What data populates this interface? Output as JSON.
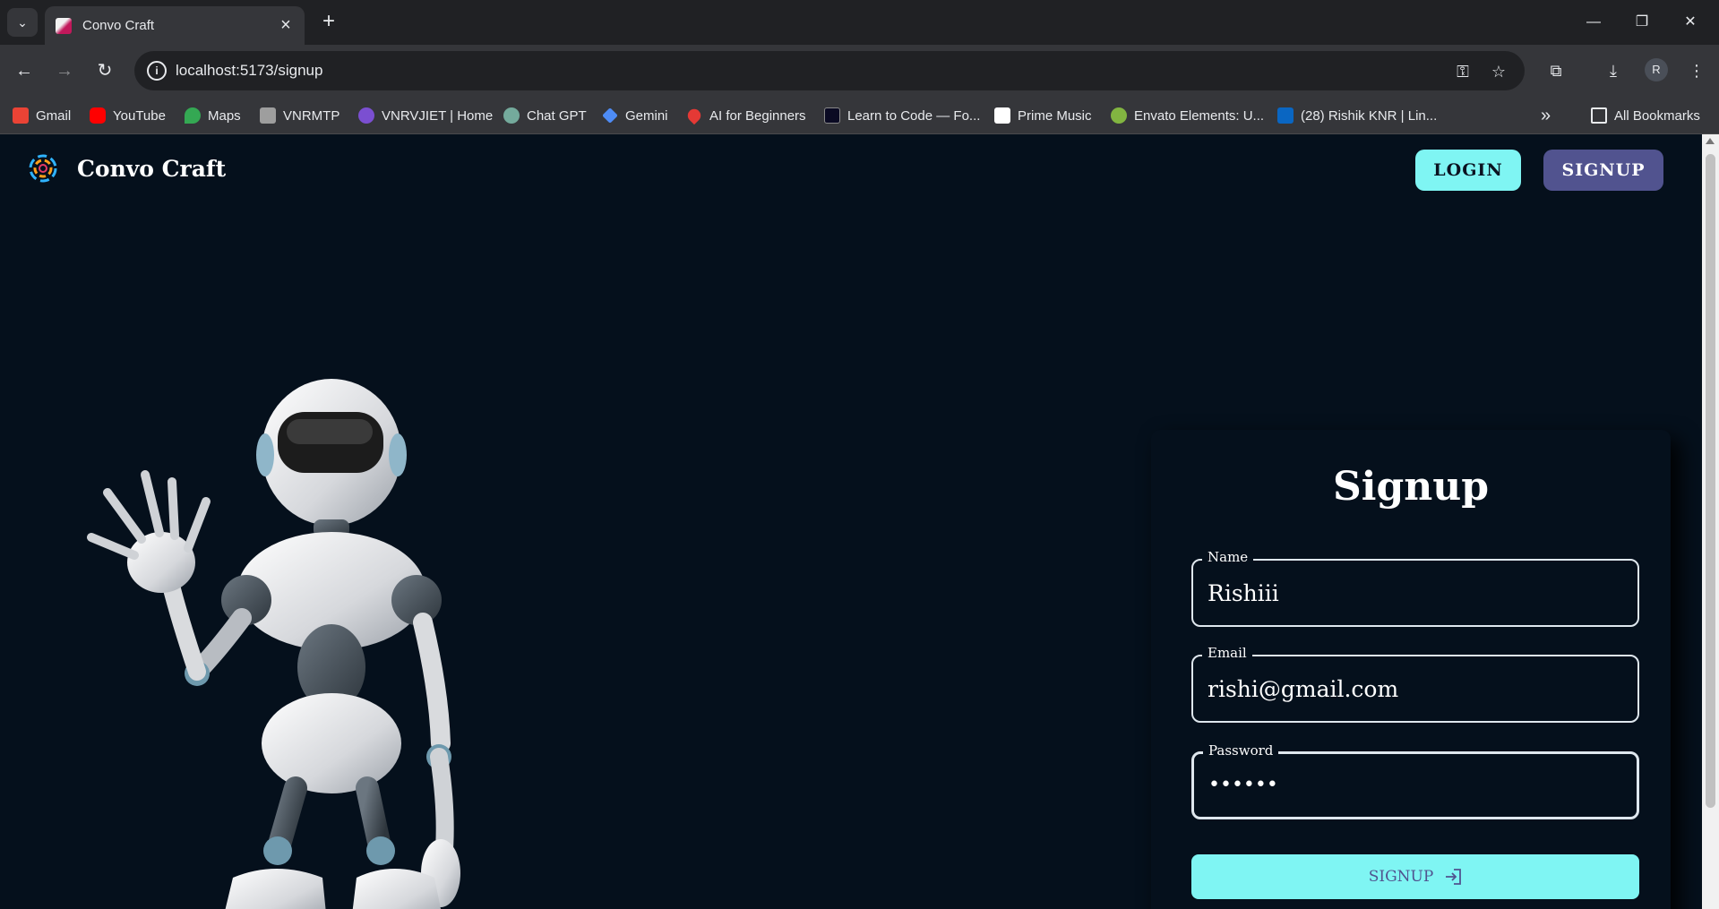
{
  "browser": {
    "tab_title": "Convo Craft",
    "new_tab": "+",
    "url": "localhost:5173/signup",
    "profile_initial": "R",
    "bookmarks": [
      {
        "label": "Gmail",
        "color": "#ea4335"
      },
      {
        "label": "YouTube",
        "color": "#ff0000"
      },
      {
        "label": "Maps",
        "color": "#34a853"
      },
      {
        "label": "VNRMTP",
        "color": "#9e9e9e"
      },
      {
        "label": "VNRVJIET | Home",
        "color": "#7b4fd1"
      },
      {
        "label": "Chat GPT",
        "color": "#74aa9c"
      },
      {
        "label": "Gemini",
        "color": "#4e8cf5"
      },
      {
        "label": "AI for Beginners",
        "color": "#e53935"
      },
      {
        "label": "Learn to Code — Fo...",
        "color": "#0a0a23"
      },
      {
        "label": "Prime Music",
        "color": "#ffffff"
      },
      {
        "label": "Envato Elements: U...",
        "color": "#82b541"
      },
      {
        "label": "(28) Rishik KNR | Lin...",
        "color": "#0a66c2"
      }
    ],
    "overflow": "»",
    "all_bookmarks": "All Bookmarks"
  },
  "header": {
    "brand": "Convo Craft",
    "login_label": "LOGIN",
    "signup_label": "SIGNUP"
  },
  "form": {
    "title": "Signup",
    "name_label": "Name",
    "name_value": "Rishiii",
    "email_label": "Email",
    "email_value": "rishi@gmail.com",
    "password_label": "Password",
    "password_value": "••••••",
    "submit_label": "SIGNUP"
  },
  "colors": {
    "accent_cyan": "#7ff5f3",
    "accent_purple": "#51538f",
    "page_bg": "#05101c"
  }
}
